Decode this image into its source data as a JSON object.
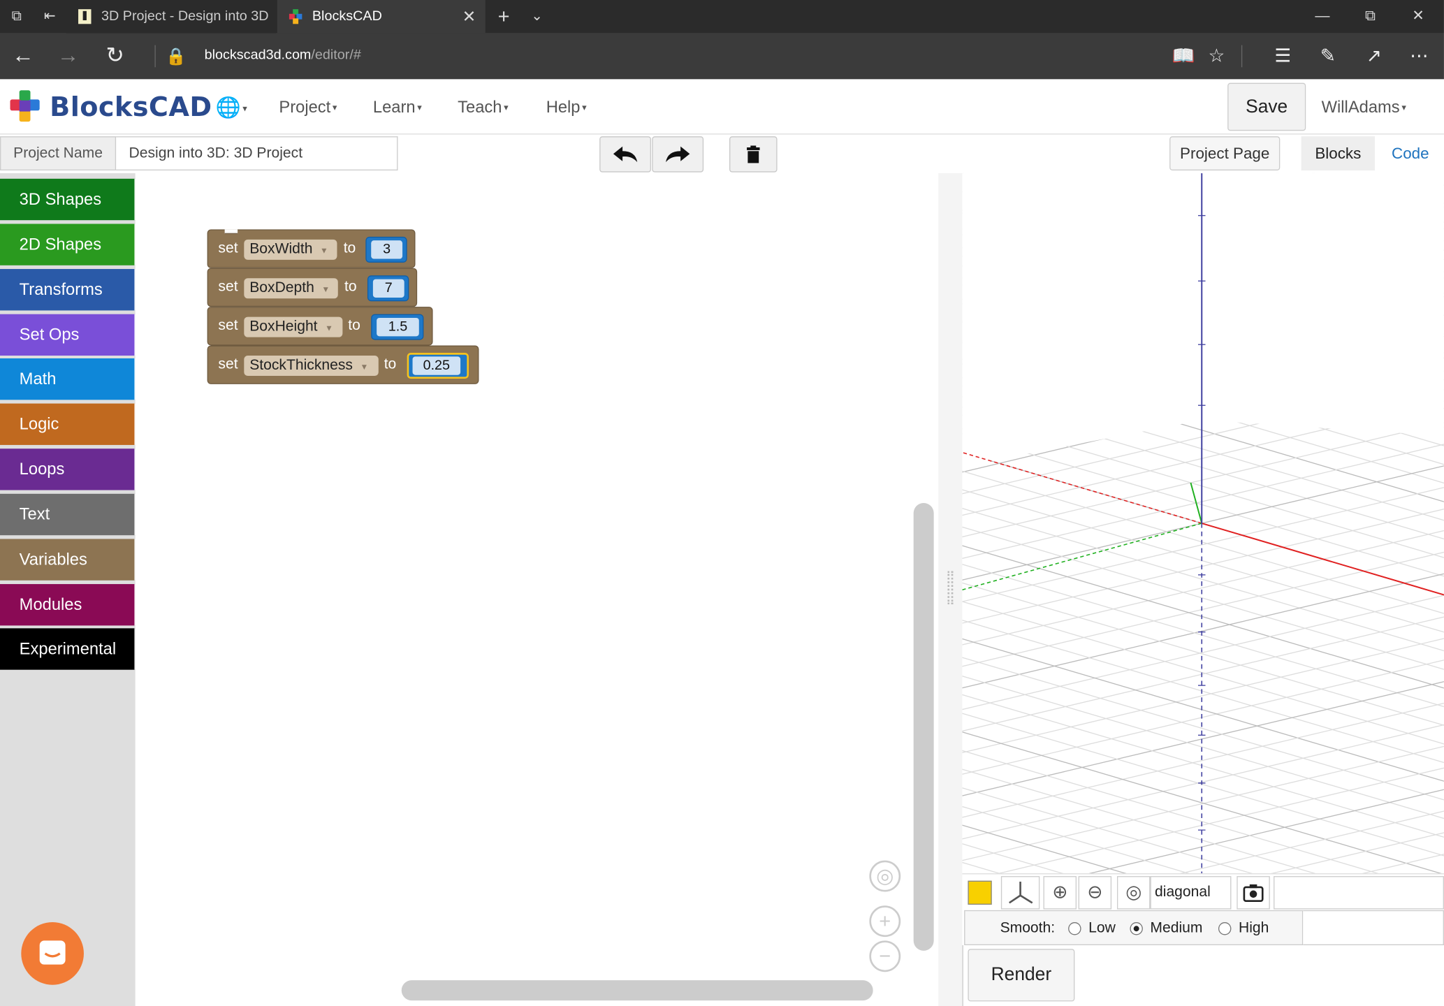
{
  "browser": {
    "tabs": [
      {
        "title": "3D Project - Design into 3D",
        "active": false
      },
      {
        "title": "BlocksCAD",
        "active": true
      }
    ],
    "url_host": "blockscad3d.com",
    "url_path": "/editor/#"
  },
  "app": {
    "logo_text": "BlocksCAD",
    "menus": [
      "Project",
      "Learn",
      "Teach",
      "Help"
    ],
    "save_label": "Save",
    "user_name": "WillAdams"
  },
  "project": {
    "name_label": "Project Name",
    "name_value": "Design into 3D: 3D Project",
    "page_button": "Project Page",
    "tabs": [
      "Blocks",
      "Code"
    ]
  },
  "categories": [
    {
      "label": "3D Shapes",
      "color": "#0f7a1b"
    },
    {
      "label": "2D Shapes",
      "color": "#2a9a1f"
    },
    {
      "label": "Transforms",
      "color": "#2a5aa8"
    },
    {
      "label": "Set Ops",
      "color": "#7a4fd8"
    },
    {
      "label": "Math",
      "color": "#0f87d8"
    },
    {
      "label": "Logic",
      "color": "#c0691f"
    },
    {
      "label": "Loops",
      "color": "#6a2b92"
    },
    {
      "label": "Text",
      "color": "#6e6e6e"
    },
    {
      "label": "Variables",
      "color": "#8d7452"
    },
    {
      "label": "Modules",
      "color": "#8a0a55"
    },
    {
      "label": "Experimental",
      "color": "#000000"
    }
  ],
  "blocks": [
    {
      "keyword": "set",
      "variable": "BoxWidth",
      "to": "to",
      "value": "3"
    },
    {
      "keyword": "set",
      "variable": "BoxDepth",
      "to": "to",
      "value": "7"
    },
    {
      "keyword": "set",
      "variable": "BoxHeight",
      "to": "to",
      "value": "1.5"
    },
    {
      "keyword": "set",
      "variable": "StockThickness",
      "to": "to",
      "value": "0.25"
    }
  ],
  "viewer": {
    "camera_view": "diagonal",
    "smooth_label": "Smooth:",
    "smooth_options": [
      "Low",
      "Medium",
      "High"
    ],
    "smooth_selected": "Medium",
    "render_label": "Render",
    "object_color": "#f8d000"
  }
}
